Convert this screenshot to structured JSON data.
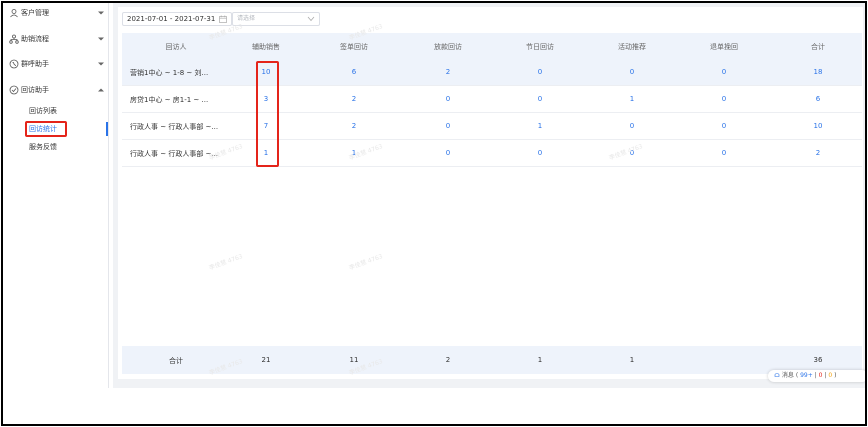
{
  "sidebar": {
    "groups": [
      {
        "label": "客户管理",
        "icon": "customer-icon"
      },
      {
        "label": "助销流程",
        "icon": "flow-icon"
      },
      {
        "label": "群呼助手",
        "icon": "call-icon"
      },
      {
        "label": "回访助手",
        "icon": "visit-icon"
      }
    ],
    "sub_items": [
      "回访列表",
      "回访统计",
      "服务反馈"
    ],
    "active_sub": "回访统计"
  },
  "filters": {
    "date_range": "2021-07-01 - 2021-07-31",
    "select_placeholder": "请选择"
  },
  "table": {
    "columns": [
      "回访人",
      "辅助销售",
      "签单回访",
      "放款回访",
      "节日回访",
      "活动推荐",
      "退单挽回",
      "合计"
    ],
    "rows": [
      [
        "营销1中心 ~ 1-8 ~ 刘...",
        "10",
        "6",
        "2",
        "0",
        "0",
        "0",
        "18"
      ],
      [
        "房贷1中心 ~ 房1-1 ~ ...",
        "3",
        "2",
        "0",
        "0",
        "1",
        "0",
        "6"
      ],
      [
        "行政人事 ~ 行政人事部 ~...",
        "7",
        "2",
        "0",
        "1",
        "0",
        "0",
        "10"
      ],
      [
        "行政人事 ~ 行政人事部 ~...",
        "1",
        "1",
        "0",
        "0",
        "0",
        "0",
        "2"
      ]
    ],
    "footer": [
      "合计",
      "21",
      "11",
      "2",
      "1",
      "1",
      "",
      "36"
    ]
  },
  "message": {
    "label": "消息",
    "count_a": "99+",
    "count_b": "0",
    "count_c": "0"
  },
  "watermark": "李佳慧 4763"
}
